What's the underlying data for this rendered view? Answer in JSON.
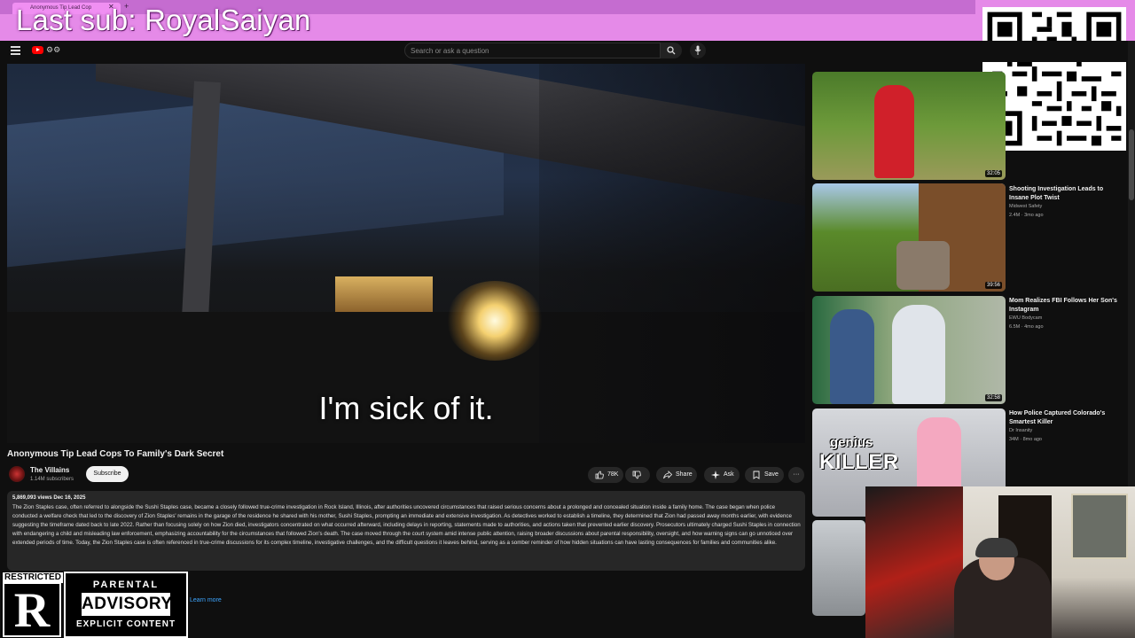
{
  "overlay": {
    "last_sub": "Last sub: RoyalSaiyan",
    "browser_tab_title": "Anonymous Tip Lead Cop"
  },
  "header": {
    "search_placeholder": "Search or ask a question"
  },
  "video": {
    "caption": "I'm sick of it.",
    "title": "Anonymous Tip Lead Cops To Family's Dark Secret",
    "channel_name": "The Villains",
    "channel_subs": "1.14M subscribers",
    "subscribe_label": "Subscribe",
    "like_count": "78K",
    "share_label": "Share",
    "ask_label": "Ask",
    "save_label": "Save",
    "more_label": "···",
    "views_date": "5,869,093 views  Dec 16, 2025",
    "description": "The Zion Staples case, often referred to alongside the Sushi Staples case, became a closely followed true-crime investigation in Rock Island, Illinois, after authorities uncovered circumstances that raised serious concerns about a prolonged and concealed situation inside a family home. The case began when police conducted a welfare check that led to the discovery of Zion Staples' remains in the garage of the residence he shared with his mother, Sushi Staples, prompting an immediate and extensive investigation. As detectives worked to establish a timeline, they determined that Zion had passed away months earlier, with evidence suggesting the timeframe dated back to late 2022. Rather than focusing solely on how Zion died, investigators concentrated on what occurred afterward, including delays in reporting, statements made to authorities, and actions taken that prevented earlier discovery. Prosecutors ultimately charged Sushi Staples in connection with endangering a child and misleading law enforcement, emphasizing accountability for the circumstances that followed Zion's death. The case moved through the court system amid intense public attention, raising broader discussions about parental responsibility, oversight, and how warning signs can go unnoticed over extended periods of time. Today, the Zion Staples case is often referenced in true-crime discussions for its complex timeline, investigative challenges, and the difficult questions it leaves behind, serving as a somber reminder of how hidden situations can have lasting consequences for families and communities alike.",
    "learn_more": "Learn more"
  },
  "badges": {
    "restricted_label": "RESTRICTED",
    "restricted_letter": "R",
    "advisory_top": "PARENTAL",
    "advisory_mid": "ADVISORY",
    "advisory_bot": "EXPLICIT CONTENT"
  },
  "sidebar": {
    "items": [
      {
        "duration": "32:05"
      },
      {
        "duration": "39:56",
        "title": "Shooting Investigation Leads to Insane Plot Twist",
        "channel": "Midwest Safety",
        "meta": "2.4M · 3mo ago"
      },
      {
        "duration": "32:58",
        "title": "Mom Realizes FBI Follows Her Son's Instagram",
        "channel": "EWU Bodycam",
        "meta": "6.5M · 4mo ago"
      },
      {
        "thumb_small": "genius",
        "thumb_big": "KILLER",
        "title": "How Police Captured Colorado's Smartest Killer",
        "channel": "Dr Insanity",
        "meta": "34M · 8mo ago"
      }
    ]
  }
}
